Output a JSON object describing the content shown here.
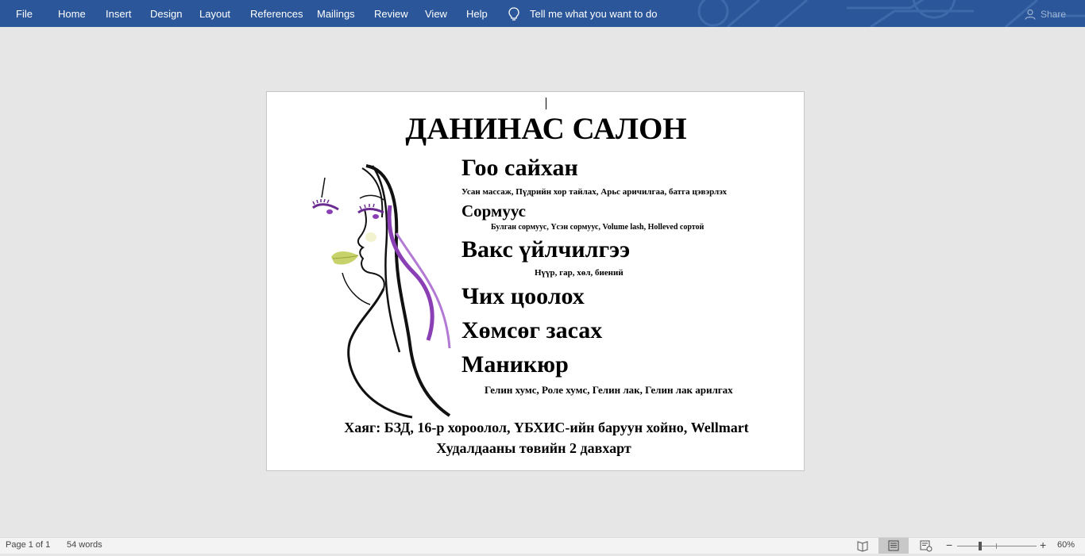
{
  "ribbon": {
    "tabs": [
      "File",
      "Home",
      "Insert",
      "Design",
      "Layout",
      "References",
      "Mailings",
      "Review",
      "View",
      "Help"
    ],
    "tell_me": "Tell me what you want to do",
    "share": "Share",
    "color": "#2b579a"
  },
  "document": {
    "title": "ДАНИНАС САЛОН",
    "services": [
      {
        "heading": "Гоо сайхан",
        "detail": "Усан массаж,  Пүдрийн хор тайлах,  Арьс аричилгаа, батга цэвэрлэх"
      },
      {
        "heading": "Сормуус",
        "detail": "Булган сормуус, Үсэн сормуус, Volume lash,  Holleved сортой"
      },
      {
        "heading": "Вакс үйлчилгээ",
        "detail": "Нүүр, гар, хөл, биений"
      },
      {
        "heading": "Чих цоолох",
        "detail": ""
      },
      {
        "heading": "Хөмсөг засах",
        "detail": ""
      },
      {
        "heading": "Маникюр",
        "detail": "Гелин хумс, Роле хумс, Гелин лак,  Гелин лак арилгах"
      }
    ],
    "address_line1": "Хаяг: БЗД, 16-р хороолол, ҮБХИС-ийн баруун хойно, Wellmart",
    "address_line2": "Худалдааны төвийн 2 давхарт",
    "accent_color": "#8b3fb5"
  },
  "status": {
    "page": "Page 1 of 1",
    "words": "54 words",
    "zoom": "60%"
  }
}
